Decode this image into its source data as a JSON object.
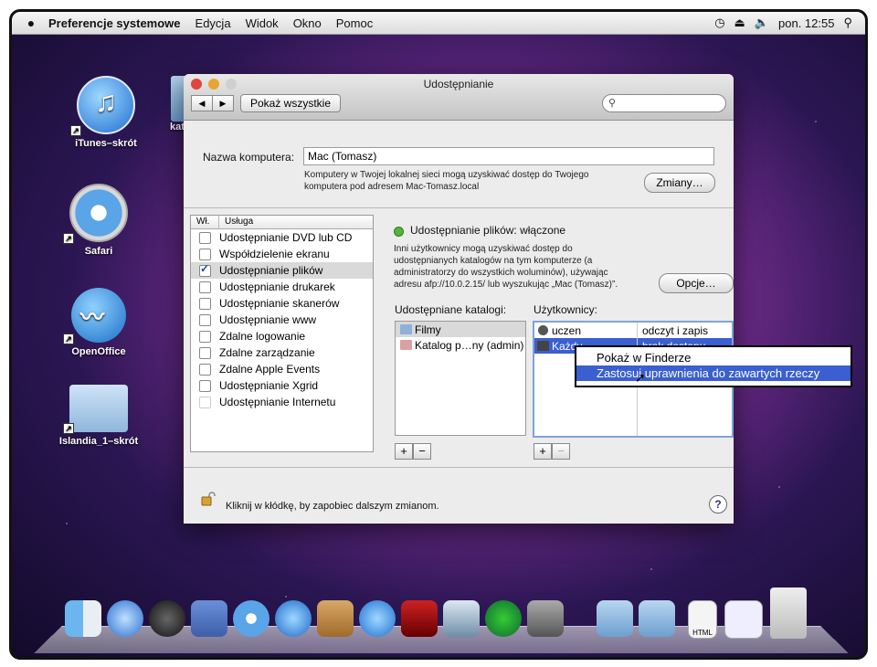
{
  "menubar": {
    "app_name": "Preferencje systemowe",
    "items": [
      "Edycja",
      "Widok",
      "Okno",
      "Pomoc"
    ],
    "clock": "pon. 12:55"
  },
  "desktop": {
    "icons": [
      {
        "label": "iTunes–skrót"
      },
      {
        "label": "Safari"
      },
      {
        "label": "OpenOffice"
      },
      {
        "label": "Islandia_1–skrót"
      }
    ],
    "partial_label": "kat"
  },
  "window": {
    "title": "Udostępnianie",
    "show_all": "Pokaż wszystkie",
    "computer_name_label": "Nazwa komputera:",
    "computer_name": "Mac (Tomasz)",
    "computer_desc_1": "Komputery w Twojej lokalnej sieci mogą uzyskiwać dostęp do Twojego",
    "computer_desc_2": "komputera pod adresem Mac-Tomasz.local",
    "edit_button": "Zmiany…",
    "services_header_on": "Wł.",
    "services_header_service": "Usługa",
    "services": [
      {
        "label": "Udostępnianie DVD lub CD",
        "checked": false
      },
      {
        "label": "Współdzielenie ekranu",
        "checked": false
      },
      {
        "label": "Udostępnianie plików",
        "checked": true
      },
      {
        "label": "Udostępnianie drukarek",
        "checked": false
      },
      {
        "label": "Udostępnianie skanerów",
        "checked": false
      },
      {
        "label": "Udostępnianie www",
        "checked": false
      },
      {
        "label": "Zdalne logowanie",
        "checked": false
      },
      {
        "label": "Zdalne zarządzanie",
        "checked": false
      },
      {
        "label": "Zdalne Apple Events",
        "checked": false
      },
      {
        "label": "Udostępnianie Xgrid",
        "checked": false
      },
      {
        "label": "Udostępnianie Internetu",
        "checked": false
      }
    ],
    "status": "Udostępnianie plików: włączone",
    "status_color": "#55b43a",
    "desc_1": "Inni użytkownicy mogą uzyskiwać dostęp do",
    "desc_2": "udostępnianych katalogów na tym komputerze (a",
    "desc_3": "administratorzy do wszystkich woluminów), używając",
    "desc_4": "adresu afp://10.0.2.15/ lub wyszukując „Mac (Tomasz)”.",
    "options_button": "Opcje…",
    "shared_folders_label": "Udostępniane katalogi:",
    "shared_folders": [
      "Filmy",
      "Katalog p…ny (admin)"
    ],
    "users_label": "Użytkownicy:",
    "users": [
      {
        "name": "uczen",
        "perm": "odczyt i zapis"
      },
      {
        "name": "Każdy",
        "perm": "brak dostępu"
      }
    ],
    "lock_text": "Kliknij w kłódkę, by zapobiec dalszym zmianom.",
    "help": "?"
  },
  "context_menu": {
    "items": [
      "Pokaż w Finderze",
      "Zastosuj uprawnienia do zawartych rzeczy"
    ],
    "highlight_color": "#3b5fd0"
  }
}
